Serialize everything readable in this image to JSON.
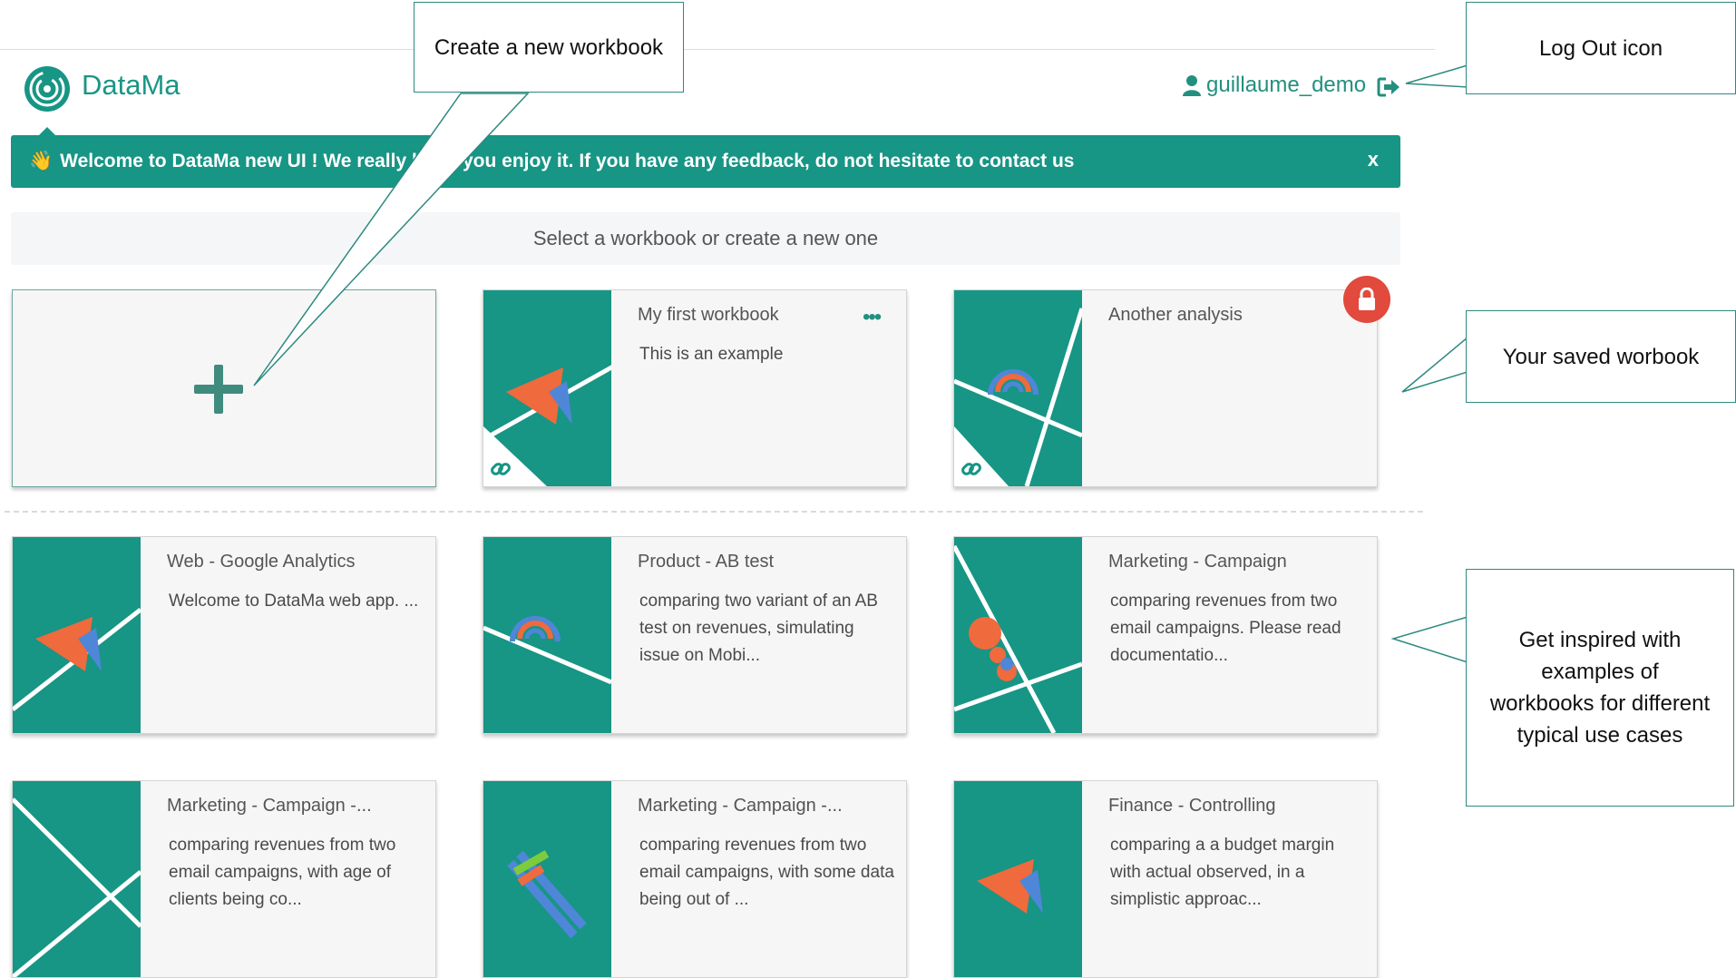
{
  "header": {
    "brand": "DataMa",
    "username": "guillaume_demo",
    "user_icon": "user-icon",
    "logout_icon": "sign-out-icon"
  },
  "banner": {
    "emoji": "👋",
    "text": "Welcome to DataMa new UI ! We really hope you enjoy it. If you have any feedback, do not hesitate to contact us",
    "close_label": "x"
  },
  "select_prompt": "Select a workbook or create a new one",
  "colors": {
    "accent": "#179585",
    "lock": "#e14a3c",
    "orange": "#ef6a3d",
    "blue": "#4f86d8"
  },
  "saved_workbooks": [
    {
      "title": "My first workbook",
      "description": "This is an example",
      "menu": "•••",
      "shared_icon": "link-icon"
    },
    {
      "title": "Another analysis",
      "description": "",
      "locked": true,
      "lock_icon": "lock-icon",
      "shared_icon": "link-icon"
    }
  ],
  "examples": [
    {
      "title": "Web - Google Analytics",
      "description": "Welcome to DataMa web app. ..."
    },
    {
      "title": "Product - AB test",
      "description": "comparing two variant of an AB test on revenues, simulating issue on Mobi..."
    },
    {
      "title": "Marketing - Campaign",
      "description": "comparing revenues from two email campaigns. Please read documentatio..."
    },
    {
      "title": "Marketing - Campaign -...",
      "description": "comparing revenues from two email campaigns, with age of clients being co..."
    },
    {
      "title": "Marketing - Campaign -...",
      "description": "comparing revenues from two email campaigns, with some data being out of ..."
    },
    {
      "title": "Finance - Controlling",
      "description": "comparing a a budget margin with actual observed, in a simplistic approac..."
    }
  ],
  "callouts": {
    "create": "Create a new workbook",
    "logout": "Log Out icon",
    "saved": "Your saved worbook",
    "inspired": "Get inspired with examples of workbooks for different typical use cases"
  }
}
